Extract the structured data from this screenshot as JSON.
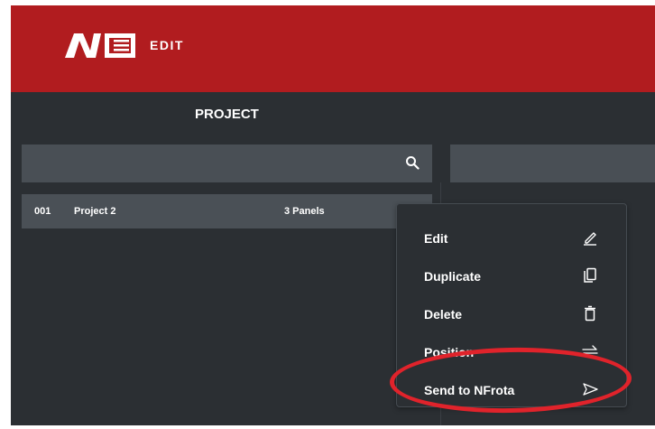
{
  "app": {
    "title": "EDIT"
  },
  "section": {
    "title": "PROJECT"
  },
  "search": {
    "placeholder": ""
  },
  "projects": [
    {
      "id": "001",
      "name": "Project 2",
      "panels": "3 Panels"
    }
  ],
  "context_menu": {
    "items": [
      {
        "label": "Edit",
        "icon": "pencil-icon"
      },
      {
        "label": "Duplicate",
        "icon": "copy-icon"
      },
      {
        "label": "Delete",
        "icon": "trash-icon"
      },
      {
        "label": "Position",
        "icon": "swap-arrows-icon"
      },
      {
        "label": "Send to NFrota",
        "icon": "send-icon"
      }
    ]
  },
  "colors": {
    "header": "#b11c1f",
    "background": "#2b2f33",
    "bar": "#494f55",
    "row": "#4a5056",
    "highlight": "#e0232b"
  }
}
